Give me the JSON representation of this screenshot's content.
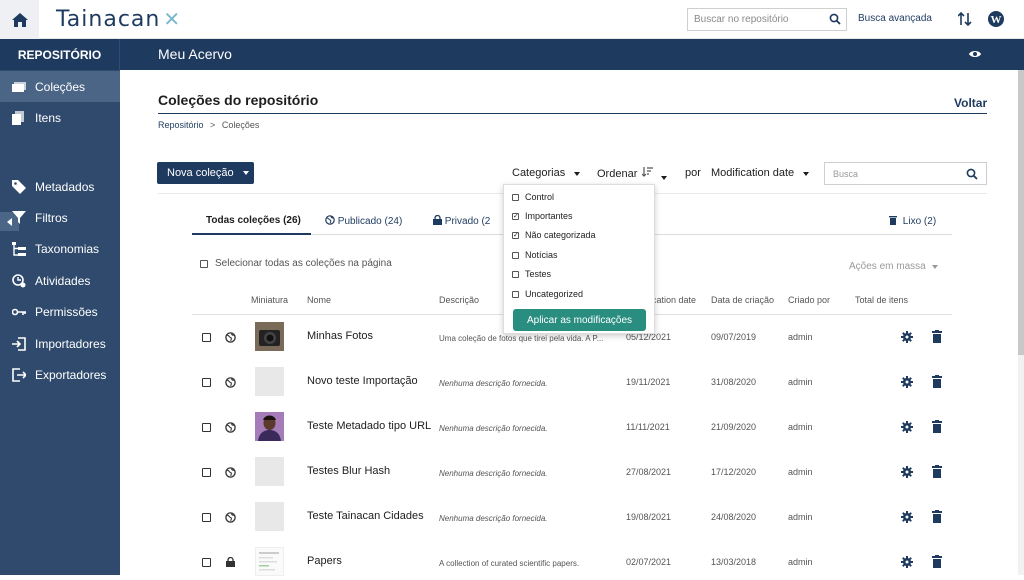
{
  "brand": {
    "logo_text": "Tainacan"
  },
  "topbar": {
    "search_placeholder": "Buscar no repositório",
    "advanced_search": "Busca avançada"
  },
  "band": {
    "repository": "REPOSITÓRIO",
    "acervo": "Meu Acervo"
  },
  "sidebar": {
    "items": [
      {
        "label": "Coleções",
        "icon": "collections-icon"
      },
      {
        "label": "Itens",
        "icon": "items-icon"
      },
      {
        "label": "Metadados",
        "icon": "tag-icon"
      },
      {
        "label": "Filtros",
        "icon": "filter-icon"
      },
      {
        "label": "Taxonomias",
        "icon": "taxonomy-icon"
      },
      {
        "label": "Atividades",
        "icon": "activity-icon"
      },
      {
        "label": "Permissões",
        "icon": "key-icon"
      },
      {
        "label": "Importadores",
        "icon": "import-icon"
      },
      {
        "label": "Exportadores",
        "icon": "export-icon"
      }
    ]
  },
  "page": {
    "title": "Coleções do repositório",
    "back": "Voltar",
    "breadcrumb_root": "Repositório",
    "breadcrumb_sep": ">",
    "breadcrumb_current": "Coleções"
  },
  "controls": {
    "new_collection": "Nova coleção",
    "categories": "Categorias",
    "order": "Ordenar",
    "by": "por",
    "sort_field": "Modification date",
    "search_placeholder": "Busca"
  },
  "tabs": {
    "all_label": "Todas coleções",
    "all_count": "(26)",
    "published_label": "Publicado",
    "published_count": "(24)",
    "private_label": "Privado",
    "private_count": "(2",
    "trash_label": "Lixo",
    "trash_count": "(2)"
  },
  "list": {
    "select_all": "Selecionar todas as coleções na página",
    "bulk_actions": "Ações em massa"
  },
  "columns": {
    "thumbnail": "Miniatura",
    "name": "Nome",
    "description": "Descrição",
    "modification": "ication date",
    "creation": "Data de criação",
    "created_by": "Criado por",
    "total": "Total de itens"
  },
  "rows": [
    {
      "name": "Minhas Fotos",
      "description": "Uma coleção de fotos que tirei pela vida. A P...",
      "modified": "05/12/2021",
      "created": "09/07/2019",
      "author": "admin",
      "visibility": "public",
      "thumb": "camera"
    },
    {
      "name": "Novo teste Importação",
      "description": "Nenhuma descrição fornecida.",
      "modified": "19/11/2021",
      "created": "31/08/2020",
      "author": "admin",
      "visibility": "public",
      "thumb": "blank"
    },
    {
      "name": "Teste Metadado tipo URL",
      "description": "Nenhuma descrição fornecida.",
      "modified": "11/11/2021",
      "created": "21/09/2020",
      "author": "admin",
      "visibility": "public",
      "thumb": "person"
    },
    {
      "name": "Testes Blur Hash",
      "description": "Nenhuma descrição fornecida.",
      "modified": "27/08/2021",
      "created": "17/12/2020",
      "author": "admin",
      "visibility": "public",
      "thumb": "blank"
    },
    {
      "name": "Teste Tainacan Cidades",
      "description": "Nenhuma descrição fornecida.",
      "modified": "19/08/2021",
      "created": "24/08/2020",
      "author": "admin",
      "visibility": "public",
      "thumb": "blank"
    },
    {
      "name": "Papers",
      "description": "A collection of curated scientific papers.",
      "modified": "02/07/2021",
      "created": "13/03/2018",
      "author": "admin",
      "visibility": "private",
      "thumb": "doc"
    }
  ],
  "dropdown": {
    "options": [
      {
        "label": "Control",
        "checked": false
      },
      {
        "label": "Importantes",
        "checked": true
      },
      {
        "label": "Não categorizada",
        "checked": true
      },
      {
        "label": "Notícias",
        "checked": false
      },
      {
        "label": "Testes",
        "checked": false
      },
      {
        "label": "Uncategorized",
        "checked": false
      }
    ],
    "apply": "Aplicar as modificações"
  },
  "colors": {
    "primary": "#1e3a5f",
    "sidebar": "#2f4a6c",
    "sidebar_active": "#4a6585",
    "apply": "#298e80"
  }
}
